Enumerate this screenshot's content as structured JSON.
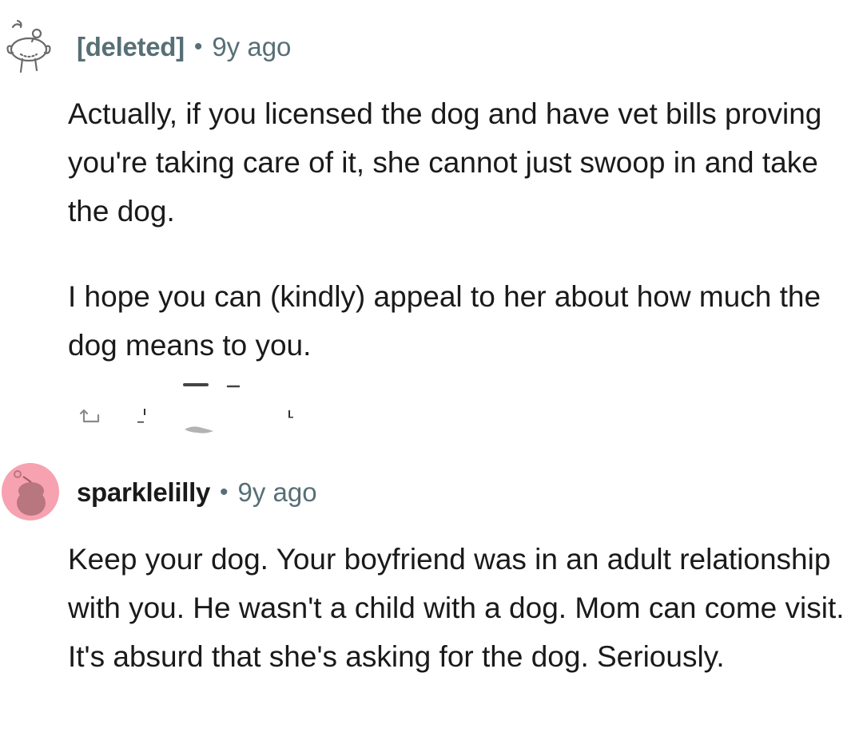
{
  "comments": [
    {
      "author": "[deleted]",
      "separator": "•",
      "age": "9y ago",
      "paragraphs": [
        "Actually, if you licensed the dog and have vet bills proving you're taking care of it, she cannot just swoop in and take the dog.",
        "I hope you can (kindly) appeal to her about how much the dog means to you."
      ],
      "avatar_icon": "deleted-snoo-outline-icon"
    },
    {
      "author": "sparklelilly",
      "separator": "•",
      "age": "9y ago",
      "paragraphs": [
        "Keep your dog. Your boyfriend was in an adult relationship with you. He wasn't a child with a dog. Mom can come visit. It's absurd that she's asking for the dog. Seriously."
      ],
      "avatar_icon": "snoo-avatar-icon",
      "avatar_color": "#f7a2b0"
    }
  ],
  "colors": {
    "meta_gray": "#576f76",
    "text": "#1a1a1b"
  }
}
